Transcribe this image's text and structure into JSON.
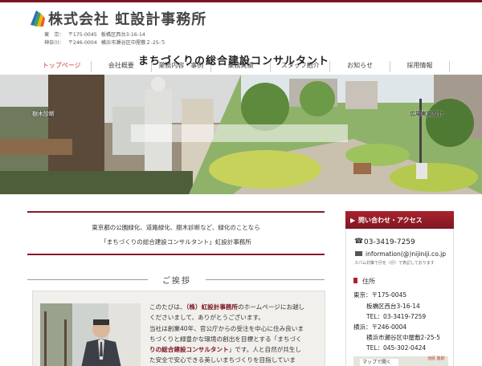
{
  "header": {
    "company_name": "株式会社 虹設計事務所",
    "address_tokyo": {
      "label": "東　京：",
      "postal": "〒175-0045",
      "address": "板橋区西台3-16-14"
    },
    "address_kanagawa": {
      "label": "神奈川：",
      "postal": "〒246-0004",
      "address": "横浜市瀬谷区中屋敷２-25-５"
    }
  },
  "nav": {
    "items": [
      "トップページ",
      "会社概要",
      "業務内容・事例",
      "業務実績",
      "スタッフ紹介",
      "お知らせ",
      "採用情報"
    ]
  },
  "hero": {
    "caption": "まちづくりの総合建設コンサルタント",
    "left_label": "樹木診断",
    "right_label": "広場実施設計"
  },
  "intro": {
    "line1": "東京都の公園緑化、道路緑化、樹木診断など、緑化のことなら",
    "line2": "「まちづくりの総合建設コンサルタント」虹設計事務所"
  },
  "greeting": {
    "heading": "ご挨拶",
    "l1_pre": "このたびは、",
    "l1_company": "（株）虹設計事務所",
    "l1_post": "のホームページにお越し",
    "l2": "くださいまして、ありがとうございます。",
    "l3": "当社は創業40年、官公庁からの受注を中心に住み良いま",
    "l4": "ちづくりと緑豊かな環境の創出を目標とする「まちづく",
    "l5_key": "りの総合建設コンサルタント",
    "l5_post": "」です。人と自然が共生し",
    "l6": "た安全で安心できる美しいまちづくりを目指していま"
  },
  "sidebar": {
    "title": "問い合わせ・アクセス",
    "phone": "03-3419-7259",
    "email": "information(@)nijiniji.co.jp",
    "spam_note": "スパム対策で＠を（＠）で表記しております",
    "address_heading": "住所",
    "tokyo_line1": "東京：〒175-0045",
    "tokyo_line2": "板橋区西台3-16-14",
    "tokyo_line3": "TEL：03-3419-7259",
    "yokohama_line1": "横浜：〒246-0004",
    "yokohama_line2": "横浜市瀬谷区中屋敷2-25-5",
    "yokohama_line3": "TEL：045-302-0424",
    "map_button": "マップで開く",
    "map_label": "池尻 陸駅"
  },
  "colors": {
    "accent": "#7a1520",
    "accent_light": "#a8232f",
    "nav_active": "#c0392b"
  },
  "icons": {
    "logo": "rainbow-logo-icon",
    "phone": "phone-icon",
    "mail": "mail-icon"
  }
}
